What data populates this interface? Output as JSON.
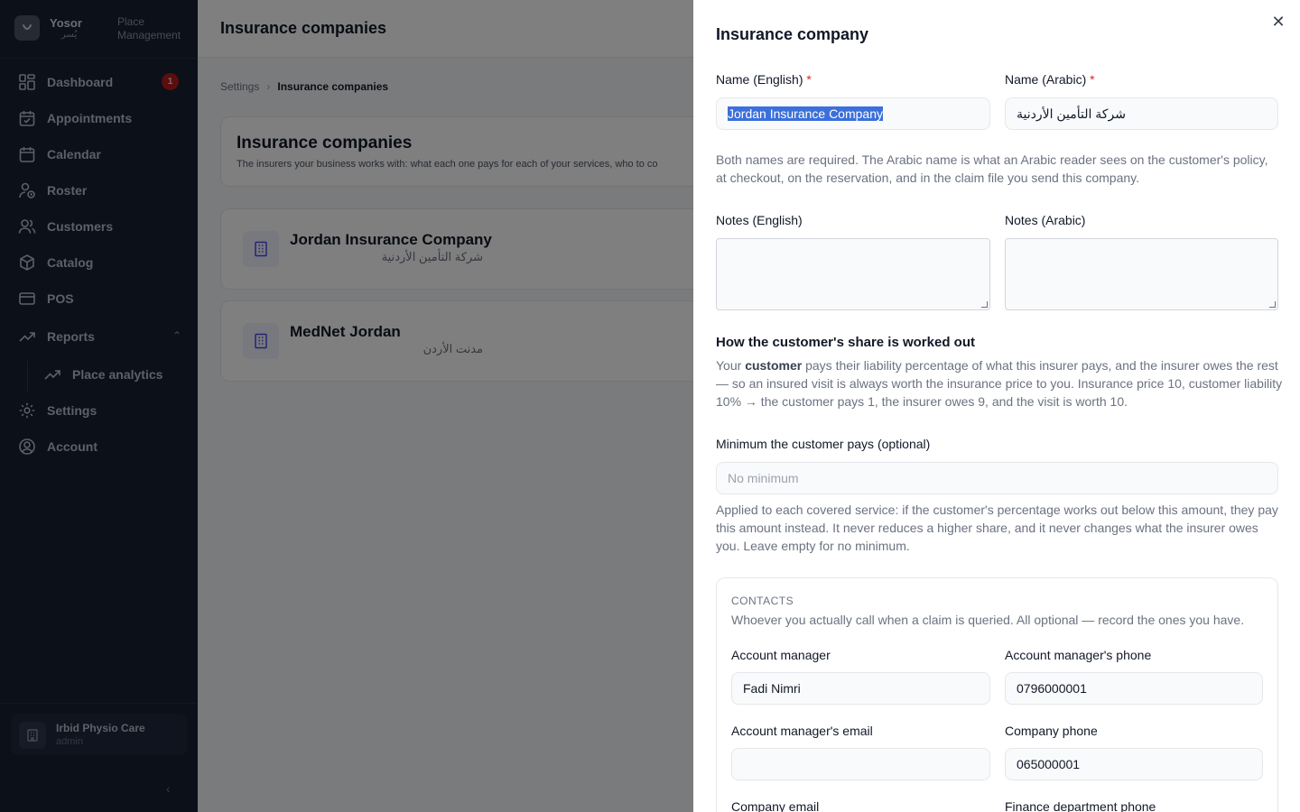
{
  "app": {
    "brand_name": "Yosor",
    "brand_arabic": "يُسر",
    "brand_sub": "Place Management"
  },
  "sidebar": {
    "items": [
      {
        "label": "Dashboard",
        "icon": "dashboard-icon",
        "badge": "1"
      },
      {
        "label": "Appointments",
        "icon": "calendar-check-icon"
      },
      {
        "label": "Calendar",
        "icon": "calendar-icon"
      },
      {
        "label": "Roster",
        "icon": "user-clock-icon"
      },
      {
        "label": "Customers",
        "icon": "users-icon"
      },
      {
        "label": "Catalog",
        "icon": "box-icon"
      },
      {
        "label": "POS",
        "icon": "credit-card-icon"
      },
      {
        "label": "Reports",
        "icon": "trending-up-icon",
        "expanded": true
      },
      {
        "label": "Settings",
        "icon": "gear-icon"
      },
      {
        "label": "Account",
        "icon": "user-circle-icon"
      }
    ],
    "sub_items": [
      {
        "label": "Place analytics",
        "icon": "trending-up-icon"
      }
    ],
    "place": {
      "name": "Irbid Physio Care",
      "role": "admin"
    }
  },
  "page": {
    "topbar_title": "Insurance companies",
    "breadcrumb": [
      "Settings",
      "Insurance companies"
    ],
    "hero_title": "Insurance companies",
    "hero_desc": "The insurers your business works with: what each one pays for each of your services, who to co",
    "companies": [
      {
        "name": "Jordan Insurance Company",
        "name_ar": "شركة التأمين الأردنية"
      },
      {
        "name": "MedNet Jordan",
        "name_ar": "مدنت الأردن"
      }
    ]
  },
  "drawer": {
    "title": "Insurance company",
    "name_en_label": "Name (English)",
    "name_en_value": "Jordan Insurance Company",
    "name_ar_label": "Name (Arabic)",
    "name_ar_value": "شركة التأمين الأردنية",
    "names_help": "Both names are required. The Arabic name is what an Arabic reader sees on the customer's policy, at checkout, on the reservation, and in the claim file you send this company.",
    "notes_en_label": "Notes (English)",
    "notes_ar_label": "Notes (Arabic)",
    "share_heading": "How the customer's share is worked out",
    "share_help_pre": "Your ",
    "share_help_bold": "customer",
    "share_help_post": " pays their liability percentage of what this insurer pays, and the insurer owes the rest — so an insured visit is always worth the insurance price to you. Insurance price 10, customer liability 10% → the customer pays 1, the insurer owes 9, and the visit is worth 10.",
    "min_label": "Minimum the customer pays (optional)",
    "min_placeholder": "No minimum",
    "min_help": "Applied to each covered service: if the customer's percentage works out below this amount, they pay this amount instead. It never reduces a higher share, and it never changes what the insurer owes you. Leave empty for no minimum.",
    "contacts": {
      "heading": "CONTACTS",
      "sub": "Whoever you actually call when a claim is queried. All optional — record the ones you have.",
      "account_manager_label": "Account manager",
      "account_manager_value": "Fadi Nimri",
      "account_manager_phone_label": "Account manager's phone",
      "account_manager_phone_value": "0796000001",
      "account_manager_email_label": "Account manager's email",
      "account_manager_email_value": "",
      "company_phone_label": "Company phone",
      "company_phone_value": "065000001",
      "company_email_label": "Company email",
      "finance_phone_label": "Finance department phone"
    }
  }
}
